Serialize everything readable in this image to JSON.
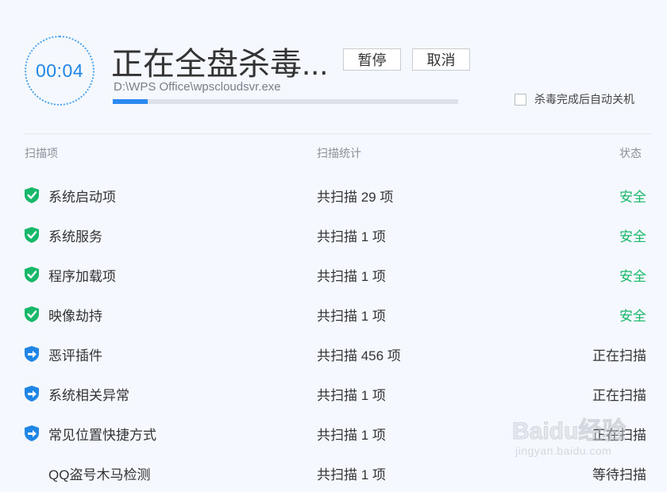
{
  "timer": {
    "time": "00:04"
  },
  "header": {
    "title": "正在全盘杀毒...",
    "pause_label": "暂停",
    "cancel_label": "取消",
    "current_file": "D:\\WPS Office\\wpscloudsvr.exe",
    "progress": 0.1,
    "auto_shutdown_label": "杀毒完成后自动关机",
    "auto_shutdown_checked": false
  },
  "columns": {
    "item": "扫描项",
    "stat": "扫描统计",
    "status": "状态"
  },
  "colors": {
    "safe": "#17b86a",
    "accent": "#1f86e6",
    "scanning": "#333333"
  },
  "rows": [
    {
      "name": "系统启动项",
      "stat": "共扫描 29 项",
      "status": "安全",
      "state": "safe",
      "icon": "shield-check-icon"
    },
    {
      "name": "系统服务",
      "stat": "共扫描 1 项",
      "status": "安全",
      "state": "safe",
      "icon": "shield-check-icon"
    },
    {
      "name": "程序加载项",
      "stat": "共扫描 1 项",
      "status": "安全",
      "state": "safe",
      "icon": "shield-check-icon"
    },
    {
      "name": "映像劫持",
      "stat": "共扫描 1 项",
      "status": "安全",
      "state": "safe",
      "icon": "shield-check-icon"
    },
    {
      "name": "恶评插件",
      "stat": "共扫描 456 项",
      "status": "正在扫描",
      "state": "scanning",
      "icon": "shield-arrow-icon"
    },
    {
      "name": "系统相关异常",
      "stat": "共扫描 1 项",
      "status": "正在扫描",
      "state": "scanning",
      "icon": "shield-arrow-icon"
    },
    {
      "name": "常见位置快捷方式",
      "stat": "共扫描 1 项",
      "status": "正在扫描",
      "state": "scanning",
      "icon": "shield-arrow-icon"
    },
    {
      "name": "QQ盗号木马检测",
      "stat": "共扫描 1 项",
      "status": "等待扫描",
      "state": "waiting",
      "icon": ""
    }
  ],
  "watermark": {
    "text": "Baidu经验",
    "url": "jingyan.baidu.com"
  }
}
